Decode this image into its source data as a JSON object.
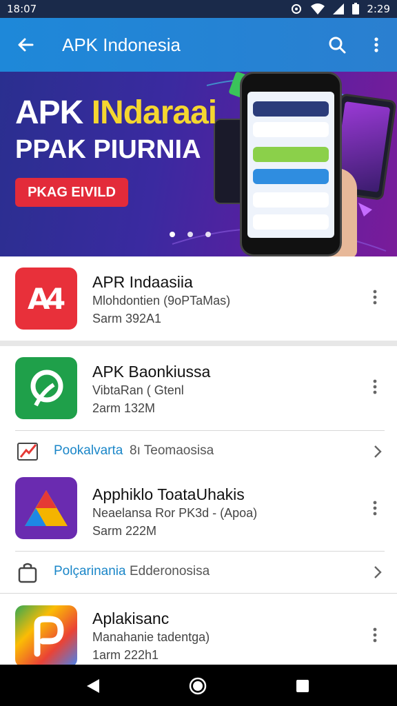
{
  "status_bar": {
    "time_left": "18:07",
    "time_right": "2:29"
  },
  "app_bar": {
    "title": "APK Indonesia"
  },
  "banner": {
    "headline_white": "APK ",
    "headline_yellow": "INdaraai",
    "subheadline": "PPAK PIURNIA",
    "cta_label": "PKAG EIVILD",
    "page_count": 3,
    "active_page": 1
  },
  "apps": [
    {
      "name": "APR Indaasiia",
      "subtitle": "Mlohdontien (9oPTaMas)",
      "size": "Sarm 392A1",
      "icon": "red-a-logo-icon",
      "color": "#e8303a"
    },
    {
      "name": "APK Baonkiussa",
      "subtitle": "VibtaRan ( Gtenl",
      "size": "2arm 132M",
      "icon": "green-p-logo-icon",
      "color": "#1fa04a"
    },
    {
      "name": "Apphiklo ToataUhakis",
      "subtitle": "Neaelansa Ror PK3d - (Apoa)",
      "size": "Sarm 222M",
      "icon": "triangle-logo-icon",
      "color": "#6a2bb0"
    },
    {
      "name": "Aplakisanc",
      "subtitle": "Manahanie tadentga)",
      "size": "1arm 222h1",
      "icon": "colorful-p-logo-icon",
      "color": "#e84d3a"
    }
  ],
  "categories": [
    {
      "label": "Pookalvarta",
      "value": "8ı Teomaosisa",
      "icon": "chart-icon"
    },
    {
      "label": "Polçarinania",
      "value": "Edderonosisa",
      "icon": "bag-icon"
    }
  ],
  "colors": {
    "app_bar": "#1e88d9",
    "accent_link": "#1a86c8",
    "cta_red": "#e32b3a",
    "banner_yellow": "#f5d630"
  }
}
